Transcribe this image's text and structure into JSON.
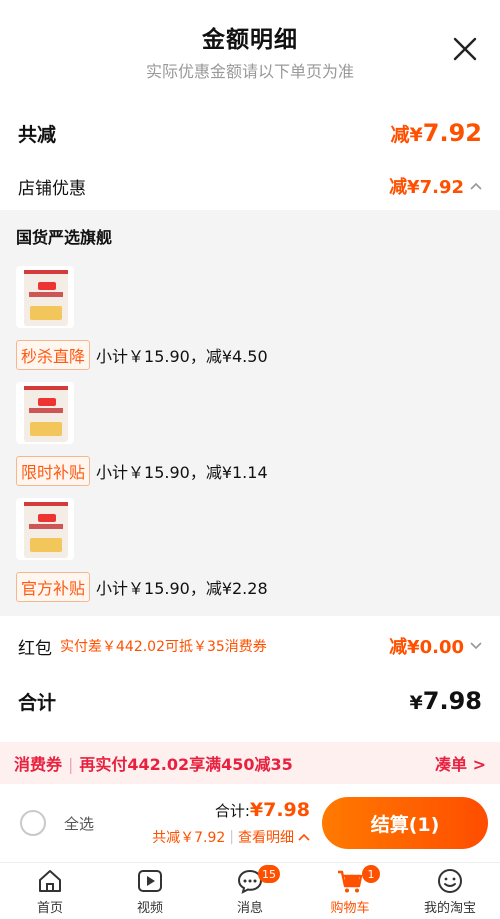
{
  "header": {
    "title": "金额明细",
    "subtitle": "实际优惠金额请以下单页为准"
  },
  "summary": {
    "total_label": "共减",
    "total_prefix": "减¥",
    "total_value": "7.92",
    "shop_label": "店铺优惠",
    "shop_amount": "减¥7.92"
  },
  "shop": {
    "name": "国货严选旗舰",
    "items": [
      {
        "tag": "秒杀直降",
        "text": "小计￥15.90，减¥4.50"
      },
      {
        "tag": "限时补贴",
        "text": "小计￥15.90，减¥1.14"
      },
      {
        "tag": "官方补贴",
        "text": "小计￥15.90，减¥2.28"
      }
    ]
  },
  "red_packet": {
    "label": "红包",
    "hint": "实付差￥442.02可抵￥35消费券",
    "amount": "减¥0.00"
  },
  "sum": {
    "label": "合计",
    "prefix": "¥",
    "value": "7.98"
  },
  "coupon_bar": {
    "tag": "消费券",
    "text": "再实付442.02享满450减35",
    "action": "凑单 >"
  },
  "checkout": {
    "select_all": "全选",
    "sum_label": "合计:",
    "sum_value": "¥7.98",
    "saved_text": "共减￥7.92",
    "detail_link": "查看明细",
    "button": "结算(1)"
  },
  "tabbar": {
    "tabs": [
      {
        "label": "首页",
        "icon": "home-icon"
      },
      {
        "label": "视频",
        "icon": "video-icon"
      },
      {
        "label": "消息",
        "icon": "message-icon",
        "badge": "15"
      },
      {
        "label": "购物车",
        "icon": "cart-icon",
        "badge": "1"
      },
      {
        "label": "我的淘宝",
        "icon": "profile-icon"
      }
    ]
  },
  "colors": {
    "accent": "#ff5000",
    "coupon_red": "#e8213f",
    "panel_bg": "#f4f4f4"
  }
}
